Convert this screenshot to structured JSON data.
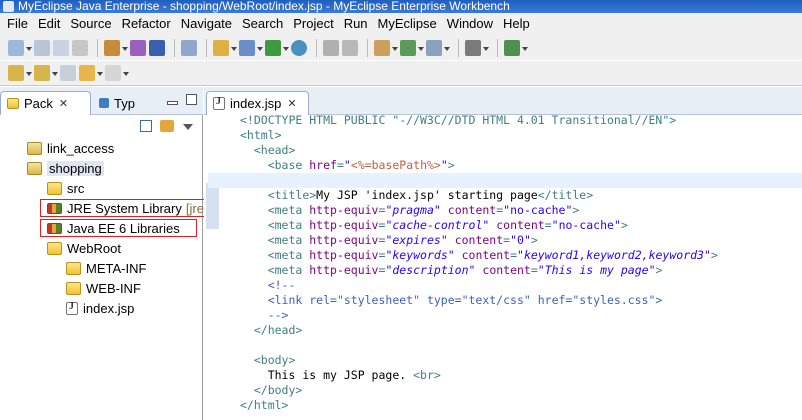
{
  "window": {
    "title": "MyEclipse Java Enterprise - shopping/WebRoot/index.jsp - MyEclipse Enterprise Workbench"
  },
  "menu": [
    "File",
    "Edit",
    "Source",
    "Refactor",
    "Navigate",
    "Search",
    "Project",
    "Run",
    "MyEclipse",
    "Window",
    "Help"
  ],
  "left_panel": {
    "tabs": [
      "Pack",
      "Typ"
    ],
    "tree": [
      {
        "label": "link_access",
        "icon": "project-icon"
      },
      {
        "label": "shopping",
        "icon": "project-icon"
      },
      {
        "label": "src",
        "icon": "source-folder-icon"
      },
      {
        "label": "JRE System Library",
        "suffix": "[jre",
        "icon": "library-icon"
      },
      {
        "label": "Java EE 6 Libraries",
        "icon": "library-icon"
      },
      {
        "label": "WebRoot",
        "icon": "folder-icon"
      },
      {
        "label": "META-INF",
        "icon": "folder-icon"
      },
      {
        "label": "WEB-INF",
        "icon": "folder-icon"
      },
      {
        "label": "index.jsp",
        "icon": "jsp-file-icon"
      }
    ]
  },
  "editor": {
    "tab": "index.jsp",
    "lines": [
      {
        "indent": "",
        "parts": [
          [
            "tag",
            "<!DOCTYPE HTML PUBLIC \"-//W3C//DTD HTML 4.01 Transitional//EN\">"
          ]
        ]
      },
      {
        "indent": "",
        "parts": [
          [
            "tag",
            "<html>"
          ]
        ]
      },
      {
        "indent": "  ",
        "parts": [
          [
            "tag",
            "<head>"
          ]
        ]
      },
      {
        "indent": "    ",
        "parts": [
          [
            "tag",
            "<base "
          ],
          [
            "attr",
            "href"
          ],
          [
            "tag",
            "="
          ],
          [
            "str",
            "\""
          ],
          [
            "jsp",
            "<%=basePath%>"
          ],
          [
            "str",
            "\""
          ],
          [
            "tag",
            ">"
          ]
        ]
      },
      {
        "indent": "",
        "parts": [],
        "current": true
      },
      {
        "indent": "    ",
        "parts": [
          [
            "tag",
            "<title>"
          ],
          [
            "text",
            "My JSP 'index.jsp' starting page"
          ],
          [
            "tag",
            "</title>"
          ]
        ]
      },
      {
        "indent": "    ",
        "parts": [
          [
            "tag",
            "<meta "
          ],
          [
            "attr",
            "http-equiv"
          ],
          [
            "tag",
            "="
          ],
          [
            "val",
            "\"pragma\""
          ],
          [
            "tag",
            " "
          ],
          [
            "attr",
            "content"
          ],
          [
            "tag",
            "="
          ],
          [
            "str",
            "\"no-cache\""
          ],
          [
            "tag",
            ">"
          ]
        ]
      },
      {
        "indent": "    ",
        "parts": [
          [
            "tag",
            "<meta "
          ],
          [
            "attr",
            "http-equiv"
          ],
          [
            "tag",
            "="
          ],
          [
            "val",
            "\"cache-control\""
          ],
          [
            "tag",
            " "
          ],
          [
            "attr",
            "content"
          ],
          [
            "tag",
            "="
          ],
          [
            "str",
            "\"no-cache\""
          ],
          [
            "tag",
            ">"
          ]
        ]
      },
      {
        "indent": "    ",
        "parts": [
          [
            "tag",
            "<meta "
          ],
          [
            "attr",
            "http-equiv"
          ],
          [
            "tag",
            "="
          ],
          [
            "val",
            "\"expires\""
          ],
          [
            "tag",
            " "
          ],
          [
            "attr",
            "content"
          ],
          [
            "tag",
            "="
          ],
          [
            "str",
            "\"0\""
          ],
          [
            "tag",
            ">"
          ]
        ]
      },
      {
        "indent": "    ",
        "parts": [
          [
            "tag",
            "<meta "
          ],
          [
            "attr",
            "http-equiv"
          ],
          [
            "tag",
            "="
          ],
          [
            "val",
            "\"keywords\""
          ],
          [
            "tag",
            " "
          ],
          [
            "attr",
            "content"
          ],
          [
            "tag",
            "="
          ],
          [
            "val",
            "\"keyword1,keyword2,keyword3\""
          ],
          [
            "tag",
            ">"
          ]
        ]
      },
      {
        "indent": "    ",
        "parts": [
          [
            "tag",
            "<meta "
          ],
          [
            "attr",
            "http-equiv"
          ],
          [
            "tag",
            "="
          ],
          [
            "val",
            "\"description\""
          ],
          [
            "tag",
            " "
          ],
          [
            "attr",
            "content"
          ],
          [
            "tag",
            "="
          ],
          [
            "val",
            "\"This is my page\""
          ],
          [
            "tag",
            ">"
          ]
        ]
      },
      {
        "indent": "    ",
        "parts": [
          [
            "cmt",
            "<!--"
          ]
        ]
      },
      {
        "indent": "    ",
        "parts": [
          [
            "cmt",
            "<link rel=\"stylesheet\" type=\"text/css\" href=\"styles.css\">"
          ]
        ]
      },
      {
        "indent": "    ",
        "parts": [
          [
            "cmt",
            "-->"
          ]
        ]
      },
      {
        "indent": "  ",
        "parts": [
          [
            "tag",
            "</head>"
          ]
        ]
      },
      {
        "indent": "",
        "parts": []
      },
      {
        "indent": "  ",
        "parts": [
          [
            "tag",
            "<body>"
          ]
        ]
      },
      {
        "indent": "    ",
        "parts": [
          [
            "text",
            "This is my JSP page. "
          ],
          [
            "tag",
            "<br>"
          ]
        ]
      },
      {
        "indent": "  ",
        "parts": [
          [
            "tag",
            "</body>"
          ]
        ]
      },
      {
        "indent": "",
        "parts": [
          [
            "tag",
            "</html>"
          ]
        ]
      }
    ]
  },
  "colors": {
    "tag": "#3f7f7f",
    "attr": "#7f007f",
    "string": "#2a00ff",
    "comment": "#3f5fbf",
    "highlight_box": "#e02020"
  }
}
